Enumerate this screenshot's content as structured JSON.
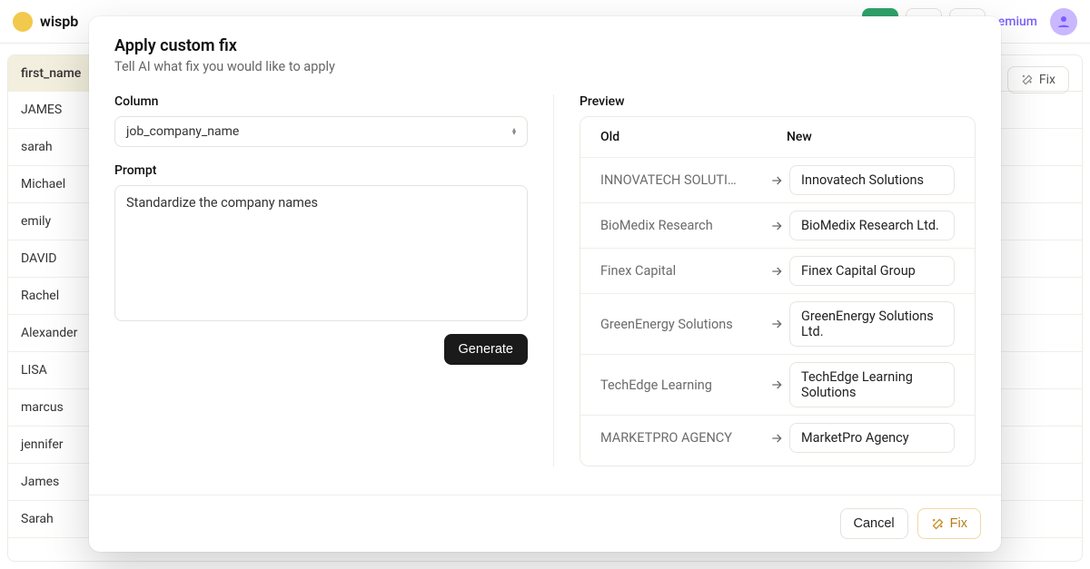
{
  "header": {
    "brand": "wispb",
    "premium_label": "emium"
  },
  "bg": {
    "column_header": "first_name",
    "rows": [
      "JAMES",
      "sarah",
      "Michael",
      "emily",
      "DAVID",
      "Rachel",
      "Alexander",
      "LISA",
      "marcus",
      "jennifer",
      "James",
      "Sarah"
    ],
    "fix_label": "Fix"
  },
  "modal": {
    "title": "Apply custom fix",
    "subtitle": "Tell AI what fix you would like to apply",
    "column_label": "Column",
    "selected_column": "job_company_name",
    "prompt_label": "Prompt",
    "prompt_value": "Standardize the company names",
    "generate_label": "Generate",
    "preview_label": "Preview",
    "preview_old": "Old",
    "preview_new": "New",
    "preview_rows": [
      {
        "old": "INNOVATECH SOLUTI…",
        "new": "Innovatech Solutions"
      },
      {
        "old": "BioMedix Research",
        "new": "BioMedix Research Ltd."
      },
      {
        "old": "Finex Capital",
        "new": "Finex Capital Group"
      },
      {
        "old": "GreenEnergy Solutions",
        "new": "GreenEnergy Solutions Ltd."
      },
      {
        "old": "TechEdge Learning",
        "new": "TechEdge Learning Solutions"
      },
      {
        "old": "MARKETPRO AGENCY",
        "new": "MarketPro Agency"
      }
    ],
    "cancel_label": "Cancel",
    "fix_label": "Fix"
  }
}
